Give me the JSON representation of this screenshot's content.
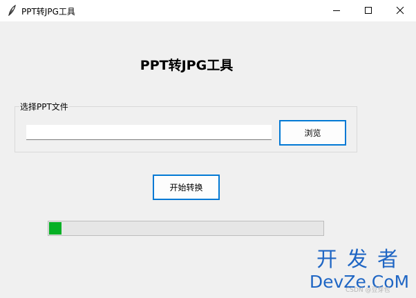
{
  "window": {
    "title": "PPT转JPG工具",
    "app_icon": "feather-icon",
    "controls": {
      "minimize_icon": "minimize-icon",
      "maximize_icon": "maximize-icon",
      "close_icon": "close-icon"
    }
  },
  "main": {
    "heading": "PPT转JPG工具",
    "file_group": {
      "label": "选择PPT文件",
      "path_value": "",
      "browse_label": "浏览"
    },
    "start_label": "开始转换",
    "progress": {
      "fraction": 0.045,
      "color": "#06b025"
    }
  },
  "watermark": {
    "cn": "开发者",
    "en": "DevZe.CoM",
    "small": "CSDN @豆芽包"
  }
}
